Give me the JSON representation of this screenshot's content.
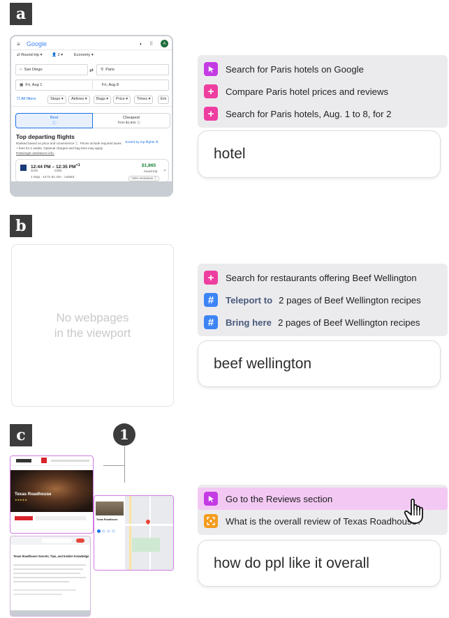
{
  "panels": {
    "a": {
      "tag": "a",
      "suggestions": [
        {
          "icon": "cursor-icon",
          "text": "Search for Paris hotels on Google"
        },
        {
          "icon": "plus-icon",
          "text": "Compare Paris hotel prices and reviews"
        },
        {
          "icon": "plus-icon",
          "text": "Search for Paris hotels, Aug. 1 to 8, for 2"
        }
      ],
      "query": "hotel",
      "screenshot": {
        "logo": "Google",
        "avatar": "A",
        "trip_type": "Round trip",
        "passengers": "2",
        "cabin": "Economy",
        "origin": "San Diego",
        "destination": "Paris",
        "depart_date": "Fri, Aug 1",
        "return_date": "Fri, Aug 8",
        "filters": [
          "All filters",
          "Stops",
          "Airlines",
          "Bags",
          "Price",
          "Times",
          "Em"
        ],
        "tab_best": "Best",
        "tab_cheapest": "Cheapest",
        "cheapest_sub": "from $1,631",
        "heading": "Top departing flights",
        "ranked_text": "Ranked based on price and convenience",
        "prices_note": "Prices include required taxes",
        "fees_line": "+ fees for 2 adults. Optional charges and bag fees may apply.",
        "assistance": "Passenger assistance info.",
        "sorted_by": "Sorted by top flights",
        "flight_times": "12:44 PM",
        "flight_arrive": "12:35 PM",
        "flight_from": "SAN",
        "flight_to": "CDG",
        "flight_stops": "1 stop · 14 hr 51 min · United",
        "flight_price": "$1,865",
        "flight_trip": "round trip",
        "emissions": "+19% emissions"
      }
    },
    "b": {
      "tag": "b",
      "empty_line1": "No webpages",
      "empty_line2": "in the viewport",
      "suggestions": [
        {
          "icon": "plus-icon",
          "verb": "",
          "text": "Search for restaurants offering Beef Wellington"
        },
        {
          "icon": "hash-icon",
          "verb": "Teleport to",
          "text": "2 pages of Beef Wellington recipes"
        },
        {
          "icon": "hash-icon",
          "verb": "Bring here",
          "text": "2 pages of Beef Wellington recipes"
        }
      ],
      "query": "beef wellington"
    },
    "c": {
      "tag": "c",
      "badge": "1",
      "suggestions": [
        {
          "icon": "cursor-icon",
          "text": "Go to the Reviews section"
        },
        {
          "icon": "scan-icon",
          "text": "What is the overall review of Texas Roadhouse?"
        }
      ],
      "query": "how do ppl like it overall",
      "screenshot_main": {
        "hero_title": "Texas Roadhouse",
        "article_title": "Texas Roadhouse Secrets, Tips, and Insider Knowledge"
      },
      "screenshot_map": {
        "place_title": "Texas Roadhouse"
      }
    }
  },
  "colors": {
    "pink": "#ee3ea0",
    "purple": "#c43be4",
    "blue": "#3d84f5",
    "orange": "#f59c1e",
    "highlight": "#f3c9f4"
  }
}
